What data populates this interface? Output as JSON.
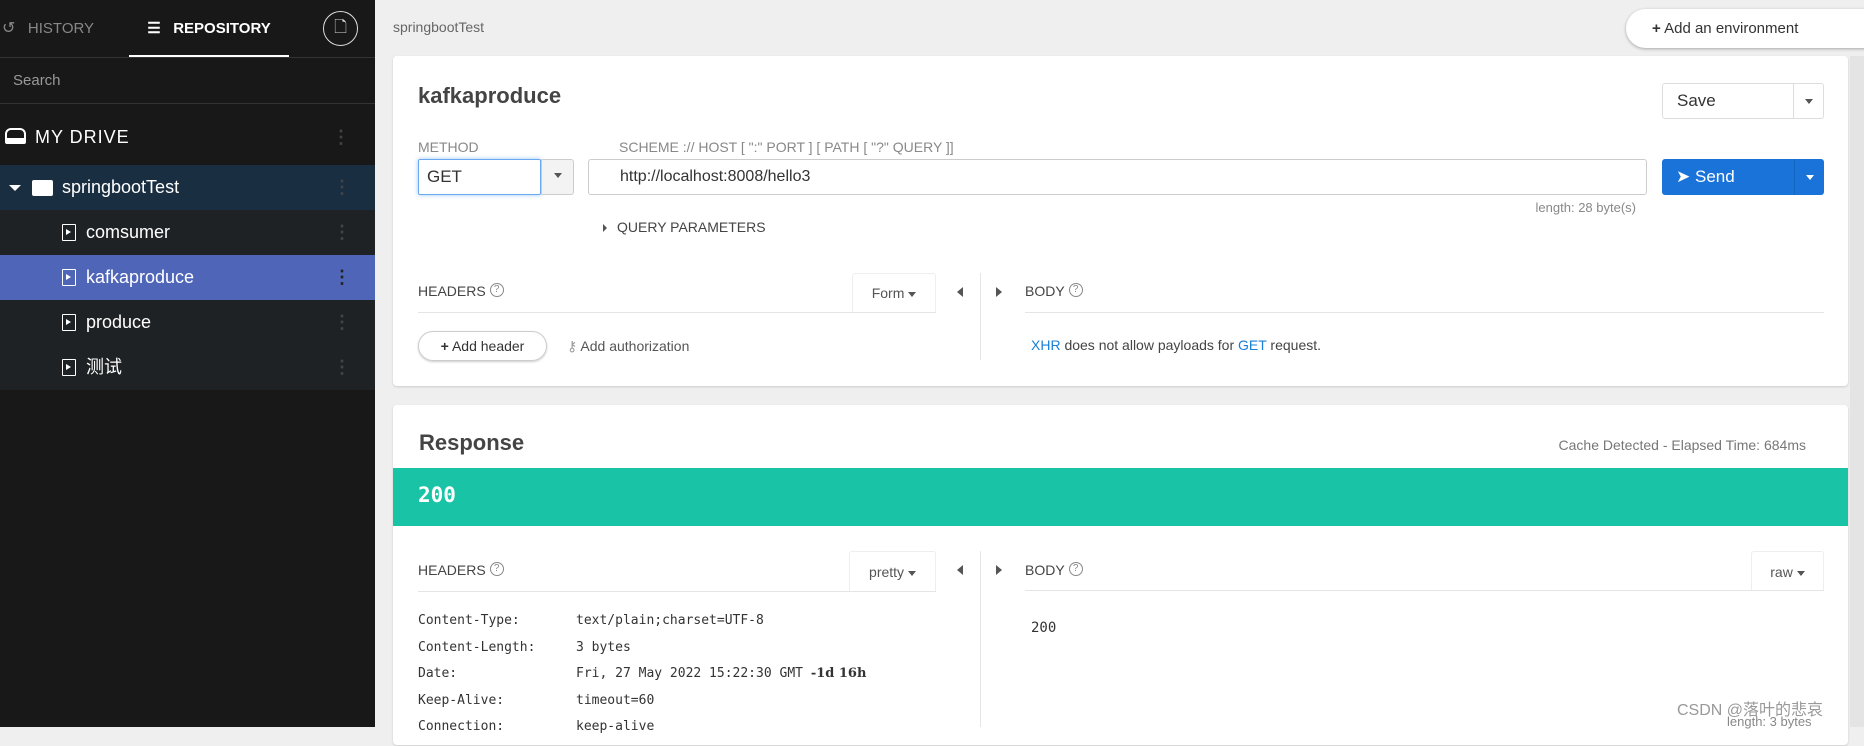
{
  "sidebar": {
    "tabs": {
      "history": "HISTORY",
      "repository": "REPOSITORY"
    },
    "search_placeholder": "Search",
    "drive": "MY DRIVE",
    "project": "springbootTest",
    "items": [
      {
        "label": "comsumer"
      },
      {
        "label": "kafkaproduce",
        "selected": true
      },
      {
        "label": "produce"
      },
      {
        "label": "测试"
      }
    ]
  },
  "breadcrumb": "springbootTest",
  "add_environment": "Add an environment",
  "request": {
    "title": "kafkaproduce",
    "save": "Save",
    "method_label": "METHOD",
    "method": "GET",
    "url_label": "SCHEME :// HOST [ \":\" PORT ] [ PATH [ \"?\" QUERY ]]",
    "url": "http://localhost:8008/hello3",
    "send": "Send",
    "length": "length: 28 byte(s)",
    "query_parameters": "QUERY PARAMETERS",
    "headers_label": "HEADERS",
    "headers_mode": "Form",
    "add_header": "Add header",
    "add_authorization": "Add authorization",
    "body_label": "BODY",
    "body_msg": {
      "a": "XHR",
      "b": " does not allow payloads for ",
      "c": "GET",
      "d": " request."
    }
  },
  "response": {
    "title": "Response",
    "timing": "Cache Detected - Elapsed Time: 684ms",
    "status": "200",
    "status_color": "#19c3a6",
    "headers_label": "HEADERS",
    "headers_mode": "pretty",
    "body_label": "BODY",
    "body_mode": "raw",
    "headers": [
      {
        "k": "Content-Type:",
        "v": "text/plain;charset=UTF-8"
      },
      {
        "k": "Content-Length:",
        "v": "3 bytes"
      },
      {
        "k": "Date:",
        "v": "Fri, 27 May 2022 15:22:30 GMT",
        "extra": "-1d 16h"
      },
      {
        "k": "Keep-Alive:",
        "v": "timeout=60"
      },
      {
        "k": "Connection:",
        "v": "keep-alive"
      }
    ],
    "body": "200",
    "length": "length: 3 bytes"
  },
  "watermark": "CSDN @落叶的悲哀"
}
